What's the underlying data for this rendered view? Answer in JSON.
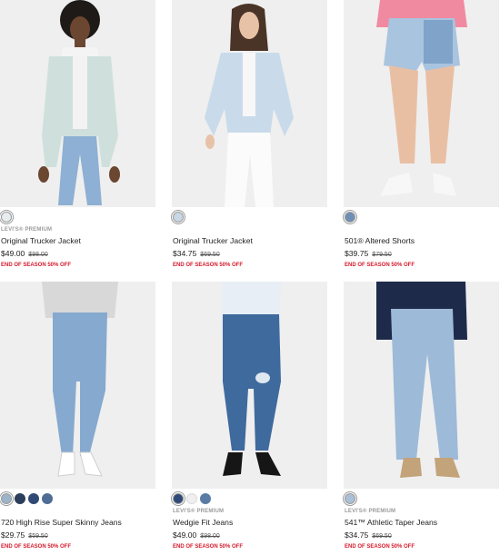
{
  "products": [
    {
      "brand": "LEVI'S® PREMIUM",
      "name": "Original Trucker Jacket",
      "price": "$49.00",
      "was": "$98.00",
      "promo": "END OF SEASON 50% OFF",
      "swatches": [
        "#e7ecef"
      ]
    },
    {
      "brand": "",
      "name": "Original Trucker Jacket",
      "price": "$34.75",
      "was": "$69.50",
      "promo": "END OF SEASON 50% OFF",
      "swatches": [
        "#c9d6e3"
      ]
    },
    {
      "brand": "",
      "name": "501® Altered Shorts",
      "price": "$39.75",
      "was": "$79.50",
      "promo": "END OF SEASON 50% OFF",
      "swatches": [
        "#6f8fb5"
      ]
    },
    {
      "brand": "",
      "name": "720 High Rise Super Skinny Jeans",
      "price": "$29.75",
      "was": "$59.50",
      "promo": "END OF SEASON 50% OFF",
      "swatches": [
        "#9bb4cc",
        "#2d3d5c",
        "#304a75",
        "#4f6c95"
      ]
    },
    {
      "brand": "LEVI'S® PREMIUM",
      "name": "Wedgie Fit Jeans",
      "price": "$49.00",
      "was": "$98.00",
      "promo": "END OF SEASON 50% OFF",
      "swatches": [
        "#2f4a78",
        "#efefef",
        "#5a7ca4"
      ]
    },
    {
      "brand": "LEVI'S® PREMIUM",
      "name": "541™ Athletic Taper Jeans",
      "price": "$34.75",
      "was": "$69.50",
      "promo": "END OF SEASON 50% OFF",
      "swatches": [
        "#a9c0d6"
      ]
    }
  ]
}
